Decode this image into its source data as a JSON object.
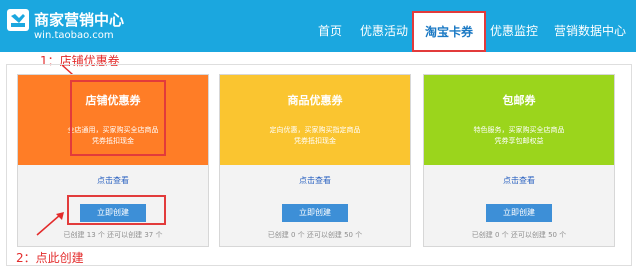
{
  "header": {
    "logo_title": "商家营销中心",
    "logo_subtitle": "win.taobao.com",
    "nav": [
      "首页",
      "优惠活动",
      "淘宝卡券",
      "优惠监控",
      "营销数据中心"
    ],
    "active_nav": "淘宝卡券"
  },
  "annotations": {
    "step1": "1：店铺优惠卷",
    "step2": "2：点此创建"
  },
  "cards": [
    {
      "title": "店铺优惠券",
      "desc_line1": "全店通用，买家购买全店商品",
      "desc_line2": "凭券抵扣现金",
      "link": "点击查看",
      "button": "立即创建",
      "stats": "已创建 13 个 还可以创建 37 个",
      "color": "#ff7d26"
    },
    {
      "title": "商品优惠券",
      "desc_line1": "定向优惠，买家购买指定商品",
      "desc_line2": "凭券抵扣现金",
      "link": "点击查看",
      "button": "立即创建",
      "stats": "已创建 0 个 还可以创建 50 个",
      "color": "#fac530"
    },
    {
      "title": "包邮券",
      "desc_line1": "特色服务，买家购买全店商品",
      "desc_line2": "凭券享包邮权益",
      "link": "点击查看",
      "button": "立即创建",
      "stats": "已创建 0 个 还可以创建 50 个",
      "color": "#9bd51c"
    }
  ]
}
